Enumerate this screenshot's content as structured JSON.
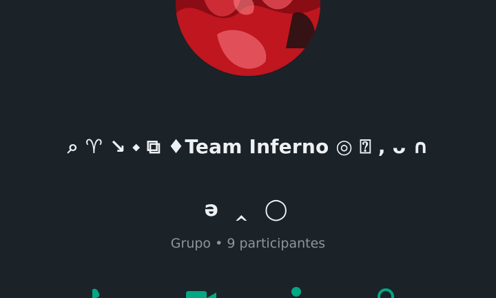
{
  "group": {
    "name_line1": "⌕ ♈ ↘ ⬩ ⧉ ♦Team Inferno ◎ ⍰ , ᴗ ∩",
    "name_line2": "ә ‸ ◯",
    "subtitle": "Grupo • 9 participantes"
  },
  "actions": [
    {
      "icon": "call-icon"
    },
    {
      "icon": "video-icon"
    },
    {
      "icon": "add-participant-icon"
    },
    {
      "icon": "search-icon"
    }
  ],
  "colors": {
    "background": "#1b2228",
    "accent": "#00a884",
    "text_primary": "#eef1f3",
    "text_secondary": "#8d979c"
  }
}
